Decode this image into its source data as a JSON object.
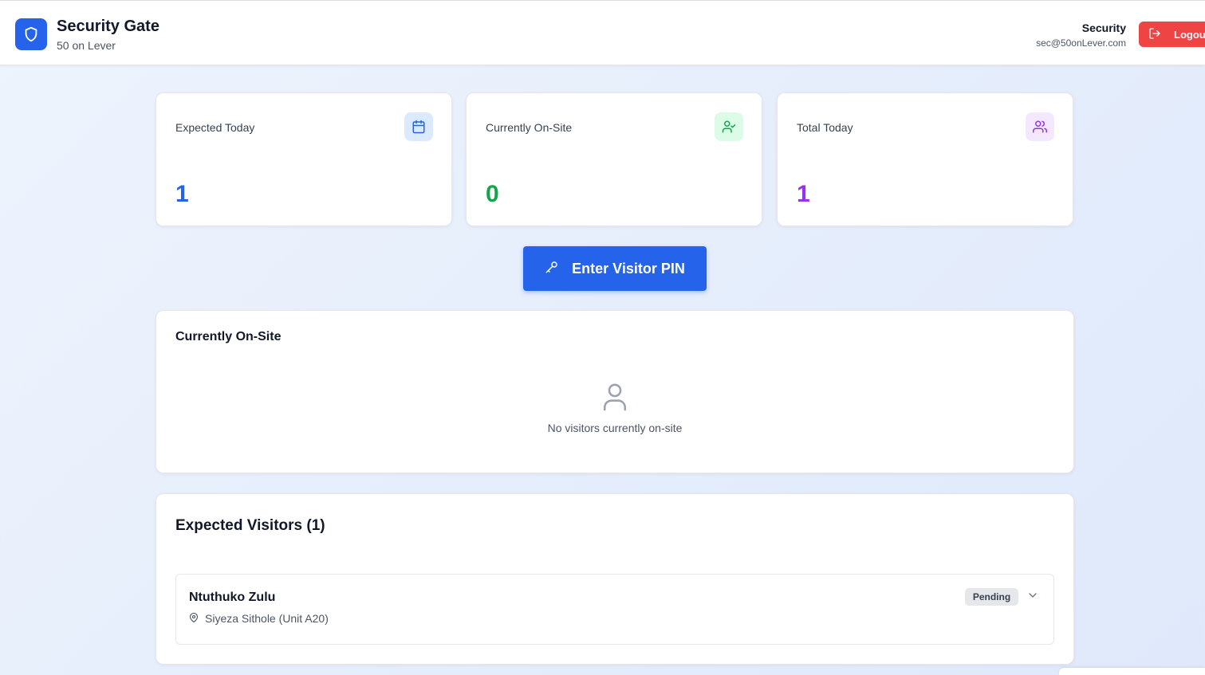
{
  "header": {
    "title": "Security Gate",
    "subtitle": "50 on Lever",
    "user_name": "Security",
    "user_email": "sec@50onLever.com",
    "logout_label": "Logout"
  },
  "stats": [
    {
      "label": "Expected Today",
      "value": "1",
      "color": "#2563eb",
      "icon_bg": "#dbeafe",
      "icon": "calendar-icon"
    },
    {
      "label": "Currently On-Site",
      "value": "0",
      "color": "#16a34a",
      "icon_bg": "#dcfce7",
      "icon": "user-check-icon"
    },
    {
      "label": "Total Today",
      "value": "1",
      "color": "#9333ea",
      "icon_bg": "#f3e8ff",
      "icon": "users-icon"
    }
  ],
  "pin_button": {
    "label": "Enter Visitor PIN",
    "icon": "key-icon"
  },
  "onsite": {
    "title": "Currently On-Site",
    "empty_text": "No visitors currently on-site"
  },
  "expected": {
    "title": "Expected Visitors (1)",
    "visitors": [
      {
        "name": "Ntuthuko Zulu",
        "host": "Siyeza Sithole (Unit A20)",
        "status": "Pending"
      }
    ]
  },
  "colors": {
    "primary": "#2563eb",
    "danger": "#ef4444",
    "success": "#16a34a",
    "purple": "#9333ea"
  }
}
